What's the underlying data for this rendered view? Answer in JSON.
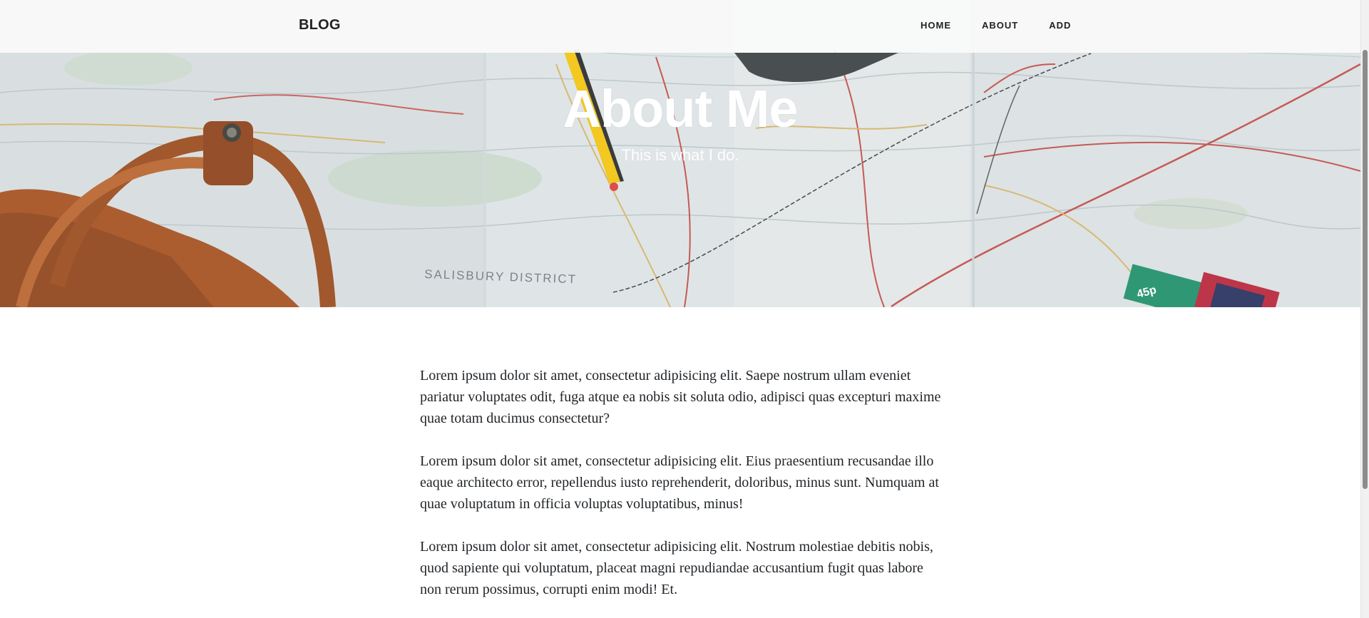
{
  "navbar": {
    "brand": "BLOG",
    "links": [
      {
        "label": "HOME"
      },
      {
        "label": "ABOUT"
      },
      {
        "label": "ADD"
      }
    ]
  },
  "masthead": {
    "title": "About Me",
    "subtitle": "This is what I do.",
    "map_text": [
      "SALISBURY DISTRICT",
      "45p"
    ]
  },
  "content": {
    "paragraphs": [
      "Lorem ipsum dolor sit amet, consectetur adipisicing elit. Saepe nostrum ullam eveniet pariatur voluptates odit, fuga atque ea nobis sit soluta odio, adipisci quas excepturi maxime quae totam ducimus consectetur?",
      "Lorem ipsum dolor sit amet, consectetur adipisicing elit. Eius praesentium recusandae illo eaque architecto error, repellendus iusto reprehenderit, doloribus, minus sunt. Numquam at quae voluptatum in officia voluptas voluptatibus, minus!",
      "Lorem ipsum dolor sit amet, consectetur adipisicing elit. Nostrum molestiae debitis nobis, quod sapiente qui voluptatum, placeat magni repudiandae accusantium fugit quas labore non rerum possimus, corrupti enim modi! Et."
    ]
  },
  "colors": {
    "text": "#212529",
    "nav_bg": "#fafafa",
    "map_base": "#dfe4e6",
    "bag_leather": "#a5501f"
  },
  "icons": {
    "scroll": "scrollbar"
  }
}
